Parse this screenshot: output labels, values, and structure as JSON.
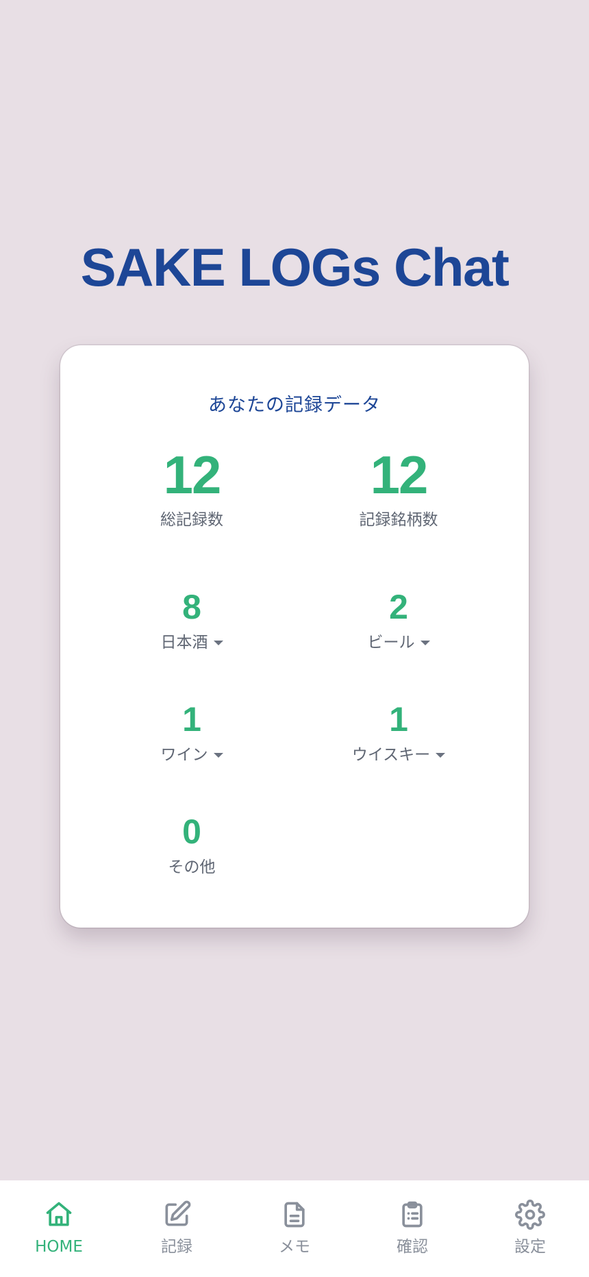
{
  "app": {
    "title": "SAKE LOGs Chat"
  },
  "stats_card": {
    "heading": "あなたの記録データ",
    "total_records": {
      "value": "12",
      "label": "総記録数"
    },
    "brands_recorded": {
      "value": "12",
      "label": "記録銘柄数"
    },
    "categories": [
      {
        "value": "8",
        "label": "日本酒",
        "has_dropdown": true
      },
      {
        "value": "2",
        "label": "ビール",
        "has_dropdown": true
      },
      {
        "value": "1",
        "label": "ワイン",
        "has_dropdown": true
      },
      {
        "value": "1",
        "label": "ウイスキー",
        "has_dropdown": true
      },
      {
        "value": "0",
        "label": "その他",
        "has_dropdown": false
      }
    ]
  },
  "bottom_nav": {
    "items": [
      {
        "label": "HOME",
        "icon": "home-icon",
        "active": true
      },
      {
        "label": "記録",
        "icon": "edit-icon",
        "active": false
      },
      {
        "label": "メモ",
        "icon": "document-icon",
        "active": false
      },
      {
        "label": "確認",
        "icon": "clipboard-icon",
        "active": false
      },
      {
        "label": "設定",
        "icon": "gear-icon",
        "active": false
      }
    ]
  },
  "colors": {
    "background": "#e8dfe5",
    "title": "#1d4696",
    "accent_green": "#33b27a",
    "muted_text": "#5f6673",
    "nav_inactive": "#8a909b"
  }
}
